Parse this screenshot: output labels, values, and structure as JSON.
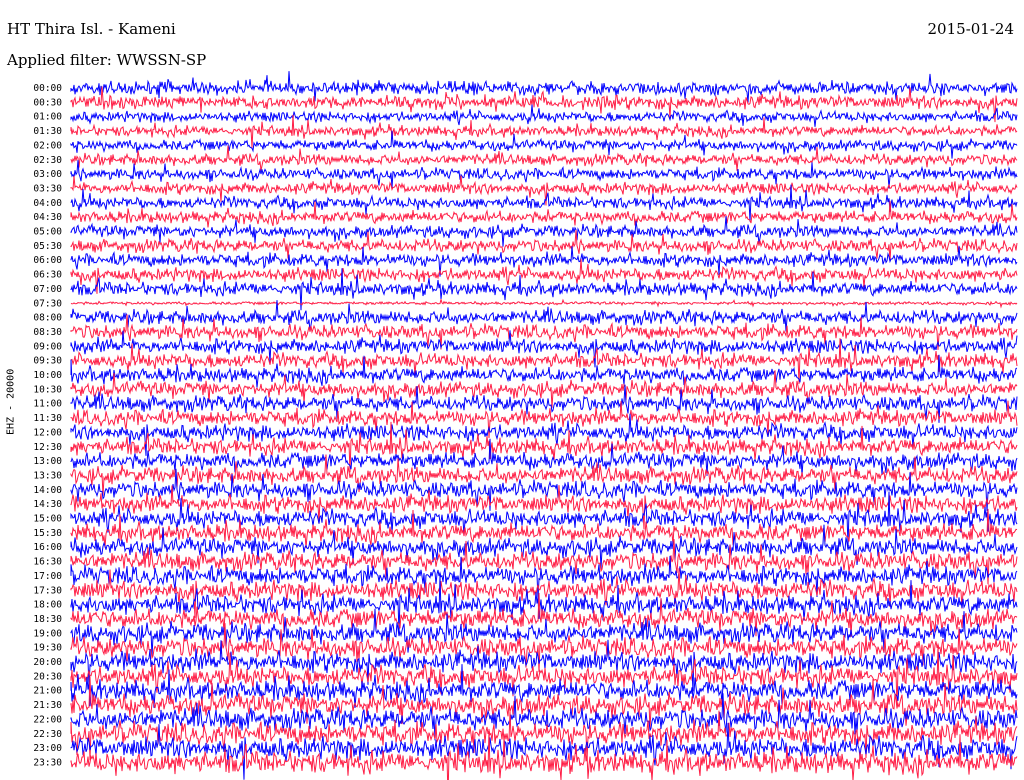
{
  "header": {
    "station": "HT Thira Isl. - Kameni",
    "date": "2015-01-24",
    "filter": "Applied filter: WWSSN-SP"
  },
  "chart_data": {
    "type": "line",
    "channel_label": "EHZ - 20000",
    "tick_labels": [
      "00:00",
      "00:30",
      "01:00",
      "01:30",
      "02:00",
      "02:30",
      "03:00",
      "03:30",
      "04:00",
      "04:30",
      "05:00",
      "05:30",
      "06:00",
      "06:30",
      "07:00",
      "07:30",
      "08:00",
      "08:30",
      "09:00",
      "09:30",
      "10:00",
      "10:30",
      "11:00",
      "11:30",
      "12:00",
      "12:30",
      "13:00",
      "13:30",
      "14:00",
      "14:30",
      "15:00",
      "15:30",
      "16:00",
      "16:30",
      "17:00",
      "17:30",
      "18:00",
      "18:30",
      "19:00",
      "19:30",
      "20:00",
      "20:30",
      "21:00",
      "21:30",
      "22:00",
      "22:30",
      "23:00",
      "23:30"
    ],
    "colors": [
      "#0000ff",
      "#ff1e46"
    ],
    "gap_rows": [
      "07:30"
    ]
  }
}
